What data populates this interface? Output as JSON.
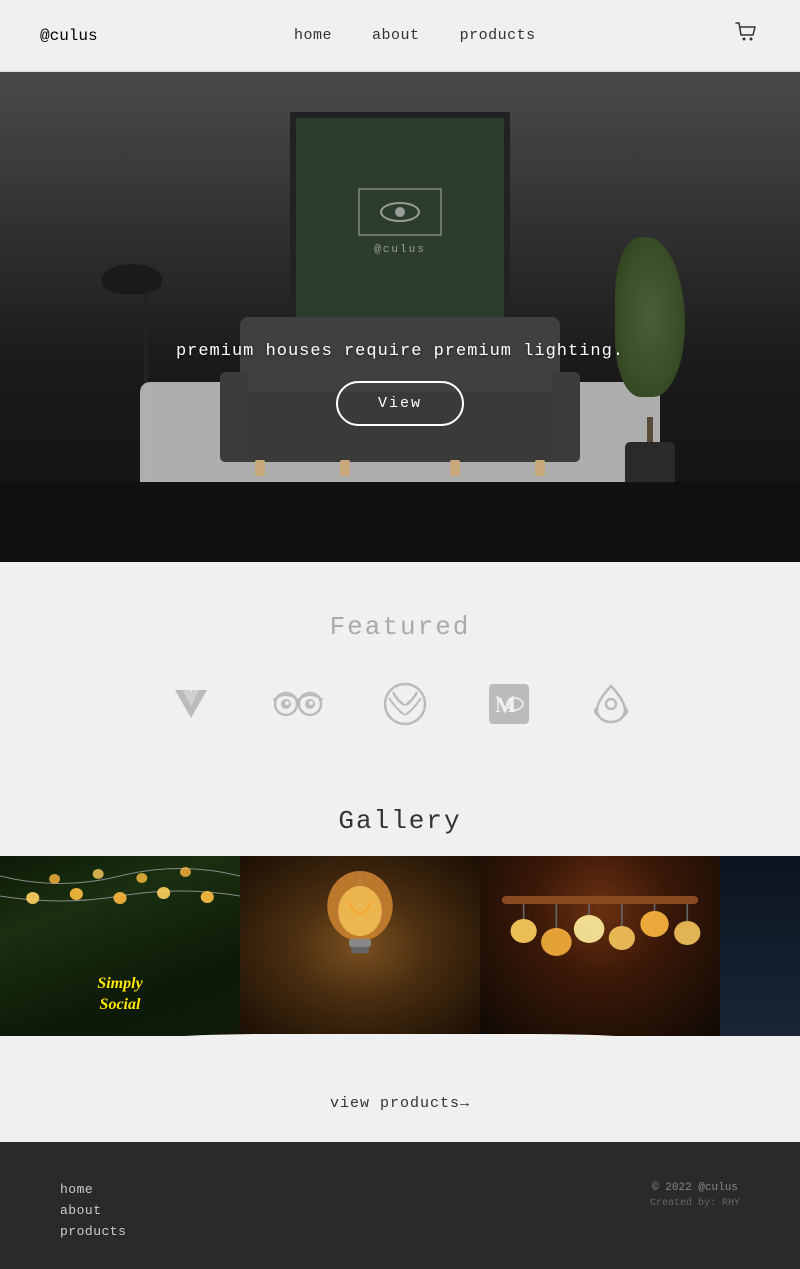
{
  "nav": {
    "logo": "@culus",
    "links": [
      "home",
      "about",
      "products"
    ],
    "cart_icon": "🛒"
  },
  "hero": {
    "tagline": "premium houses require premium lighting.",
    "cta_label": "View",
    "painting_brand": "@culus"
  },
  "featured": {
    "title": "Featured",
    "logos": [
      {
        "name": "vultr",
        "icon": "vultr-icon"
      },
      {
        "name": "tripadvisor",
        "icon": "tripadvisor-icon"
      },
      {
        "name": "xbox",
        "icon": "xbox-icon"
      },
      {
        "name": "medium",
        "icon": "medium-icon"
      },
      {
        "name": "airbnb",
        "icon": "airbnb-icon"
      }
    ]
  },
  "gallery": {
    "title": "Gallery",
    "view_products_label": "view products→",
    "images": [
      {
        "label": "Simply Social",
        "alt": "cafe lights with plants"
      },
      {
        "label": "",
        "alt": "vintage Edison bulb"
      },
      {
        "label": "",
        "alt": "multiple globe bulbs on track"
      },
      {
        "label": "",
        "alt": "dark interior"
      }
    ]
  },
  "footer": {
    "links": [
      "home",
      "about",
      "products"
    ],
    "copyright": "© 2022 @culus",
    "created_by": "Created by: RHY"
  }
}
